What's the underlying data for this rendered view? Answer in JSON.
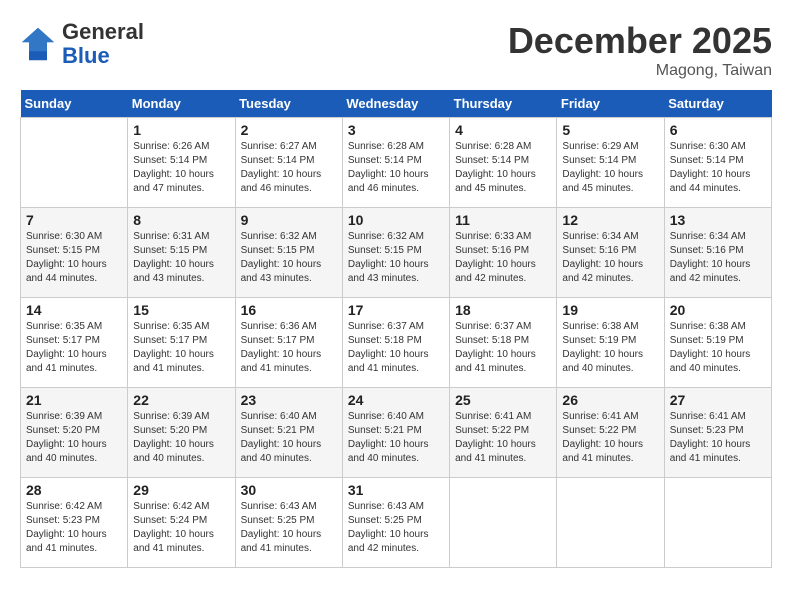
{
  "header": {
    "logo_general": "General",
    "logo_blue": "Blue",
    "month_title": "December 2025",
    "location": "Magong, Taiwan"
  },
  "weekdays": [
    "Sunday",
    "Monday",
    "Tuesday",
    "Wednesday",
    "Thursday",
    "Friday",
    "Saturday"
  ],
  "weeks": [
    [
      {
        "day": "",
        "info": ""
      },
      {
        "day": "1",
        "info": "Sunrise: 6:26 AM\nSunset: 5:14 PM\nDaylight: 10 hours\nand 47 minutes."
      },
      {
        "day": "2",
        "info": "Sunrise: 6:27 AM\nSunset: 5:14 PM\nDaylight: 10 hours\nand 46 minutes."
      },
      {
        "day": "3",
        "info": "Sunrise: 6:28 AM\nSunset: 5:14 PM\nDaylight: 10 hours\nand 46 minutes."
      },
      {
        "day": "4",
        "info": "Sunrise: 6:28 AM\nSunset: 5:14 PM\nDaylight: 10 hours\nand 45 minutes."
      },
      {
        "day": "5",
        "info": "Sunrise: 6:29 AM\nSunset: 5:14 PM\nDaylight: 10 hours\nand 45 minutes."
      },
      {
        "day": "6",
        "info": "Sunrise: 6:30 AM\nSunset: 5:14 PM\nDaylight: 10 hours\nand 44 minutes."
      }
    ],
    [
      {
        "day": "7",
        "info": "Sunrise: 6:30 AM\nSunset: 5:15 PM\nDaylight: 10 hours\nand 44 minutes."
      },
      {
        "day": "8",
        "info": "Sunrise: 6:31 AM\nSunset: 5:15 PM\nDaylight: 10 hours\nand 43 minutes."
      },
      {
        "day": "9",
        "info": "Sunrise: 6:32 AM\nSunset: 5:15 PM\nDaylight: 10 hours\nand 43 minutes."
      },
      {
        "day": "10",
        "info": "Sunrise: 6:32 AM\nSunset: 5:15 PM\nDaylight: 10 hours\nand 43 minutes."
      },
      {
        "day": "11",
        "info": "Sunrise: 6:33 AM\nSunset: 5:16 PM\nDaylight: 10 hours\nand 42 minutes."
      },
      {
        "day": "12",
        "info": "Sunrise: 6:34 AM\nSunset: 5:16 PM\nDaylight: 10 hours\nand 42 minutes."
      },
      {
        "day": "13",
        "info": "Sunrise: 6:34 AM\nSunset: 5:16 PM\nDaylight: 10 hours\nand 42 minutes."
      }
    ],
    [
      {
        "day": "14",
        "info": "Sunrise: 6:35 AM\nSunset: 5:17 PM\nDaylight: 10 hours\nand 41 minutes."
      },
      {
        "day": "15",
        "info": "Sunrise: 6:35 AM\nSunset: 5:17 PM\nDaylight: 10 hours\nand 41 minutes."
      },
      {
        "day": "16",
        "info": "Sunrise: 6:36 AM\nSunset: 5:17 PM\nDaylight: 10 hours\nand 41 minutes."
      },
      {
        "day": "17",
        "info": "Sunrise: 6:37 AM\nSunset: 5:18 PM\nDaylight: 10 hours\nand 41 minutes."
      },
      {
        "day": "18",
        "info": "Sunrise: 6:37 AM\nSunset: 5:18 PM\nDaylight: 10 hours\nand 41 minutes."
      },
      {
        "day": "19",
        "info": "Sunrise: 6:38 AM\nSunset: 5:19 PM\nDaylight: 10 hours\nand 40 minutes."
      },
      {
        "day": "20",
        "info": "Sunrise: 6:38 AM\nSunset: 5:19 PM\nDaylight: 10 hours\nand 40 minutes."
      }
    ],
    [
      {
        "day": "21",
        "info": "Sunrise: 6:39 AM\nSunset: 5:20 PM\nDaylight: 10 hours\nand 40 minutes."
      },
      {
        "day": "22",
        "info": "Sunrise: 6:39 AM\nSunset: 5:20 PM\nDaylight: 10 hours\nand 40 minutes."
      },
      {
        "day": "23",
        "info": "Sunrise: 6:40 AM\nSunset: 5:21 PM\nDaylight: 10 hours\nand 40 minutes."
      },
      {
        "day": "24",
        "info": "Sunrise: 6:40 AM\nSunset: 5:21 PM\nDaylight: 10 hours\nand 40 minutes."
      },
      {
        "day": "25",
        "info": "Sunrise: 6:41 AM\nSunset: 5:22 PM\nDaylight: 10 hours\nand 41 minutes."
      },
      {
        "day": "26",
        "info": "Sunrise: 6:41 AM\nSunset: 5:22 PM\nDaylight: 10 hours\nand 41 minutes."
      },
      {
        "day": "27",
        "info": "Sunrise: 6:41 AM\nSunset: 5:23 PM\nDaylight: 10 hours\nand 41 minutes."
      }
    ],
    [
      {
        "day": "28",
        "info": "Sunrise: 6:42 AM\nSunset: 5:23 PM\nDaylight: 10 hours\nand 41 minutes."
      },
      {
        "day": "29",
        "info": "Sunrise: 6:42 AM\nSunset: 5:24 PM\nDaylight: 10 hours\nand 41 minutes."
      },
      {
        "day": "30",
        "info": "Sunrise: 6:43 AM\nSunset: 5:25 PM\nDaylight: 10 hours\nand 41 minutes."
      },
      {
        "day": "31",
        "info": "Sunrise: 6:43 AM\nSunset: 5:25 PM\nDaylight: 10 hours\nand 42 minutes."
      },
      {
        "day": "",
        "info": ""
      },
      {
        "day": "",
        "info": ""
      },
      {
        "day": "",
        "info": ""
      }
    ]
  ]
}
